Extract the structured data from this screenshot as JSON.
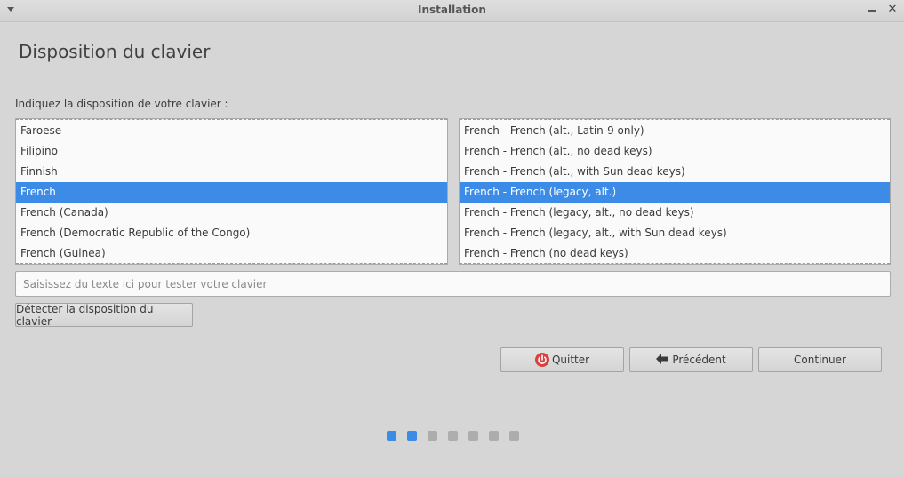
{
  "window": {
    "title": "Installation"
  },
  "page": {
    "heading": "Disposition du clavier",
    "prompt": "Indiquez la disposition de votre clavier :"
  },
  "layouts": {
    "items": [
      "Faroese",
      "Filipino",
      "Finnish",
      "French",
      "French (Canada)",
      "French (Democratic Republic of the Congo)",
      "French (Guinea)"
    ],
    "selected": "French"
  },
  "variants": {
    "items": [
      "French - French (alt., Latin-9 only)",
      "French - French (alt., no dead keys)",
      "French - French (alt., with Sun dead keys)",
      "French - French (legacy, alt.)",
      "French - French (legacy, alt., no dead keys)",
      "French - French (legacy, alt., with Sun dead keys)",
      "French - French (no dead keys)"
    ],
    "selected": "French - French (legacy, alt.)"
  },
  "test_field": {
    "placeholder": "Saisissez du texte ici pour tester votre clavier",
    "value": ""
  },
  "buttons": {
    "detect": "Détecter la disposition du clavier",
    "quit": "Quitter",
    "back": "Précédent",
    "continue": "Continuer"
  },
  "progress": {
    "total_steps": 7,
    "current_step": 2
  },
  "colors": {
    "accent": "#3c8ce7",
    "quit_icon": "#d9413f",
    "background": "#d6d6d6"
  },
  "icons": {
    "quit": "power-icon",
    "back": "arrow-left-icon",
    "window_menu": "chevron-down-icon",
    "minimize": "minimize-icon",
    "close": "close-icon"
  }
}
